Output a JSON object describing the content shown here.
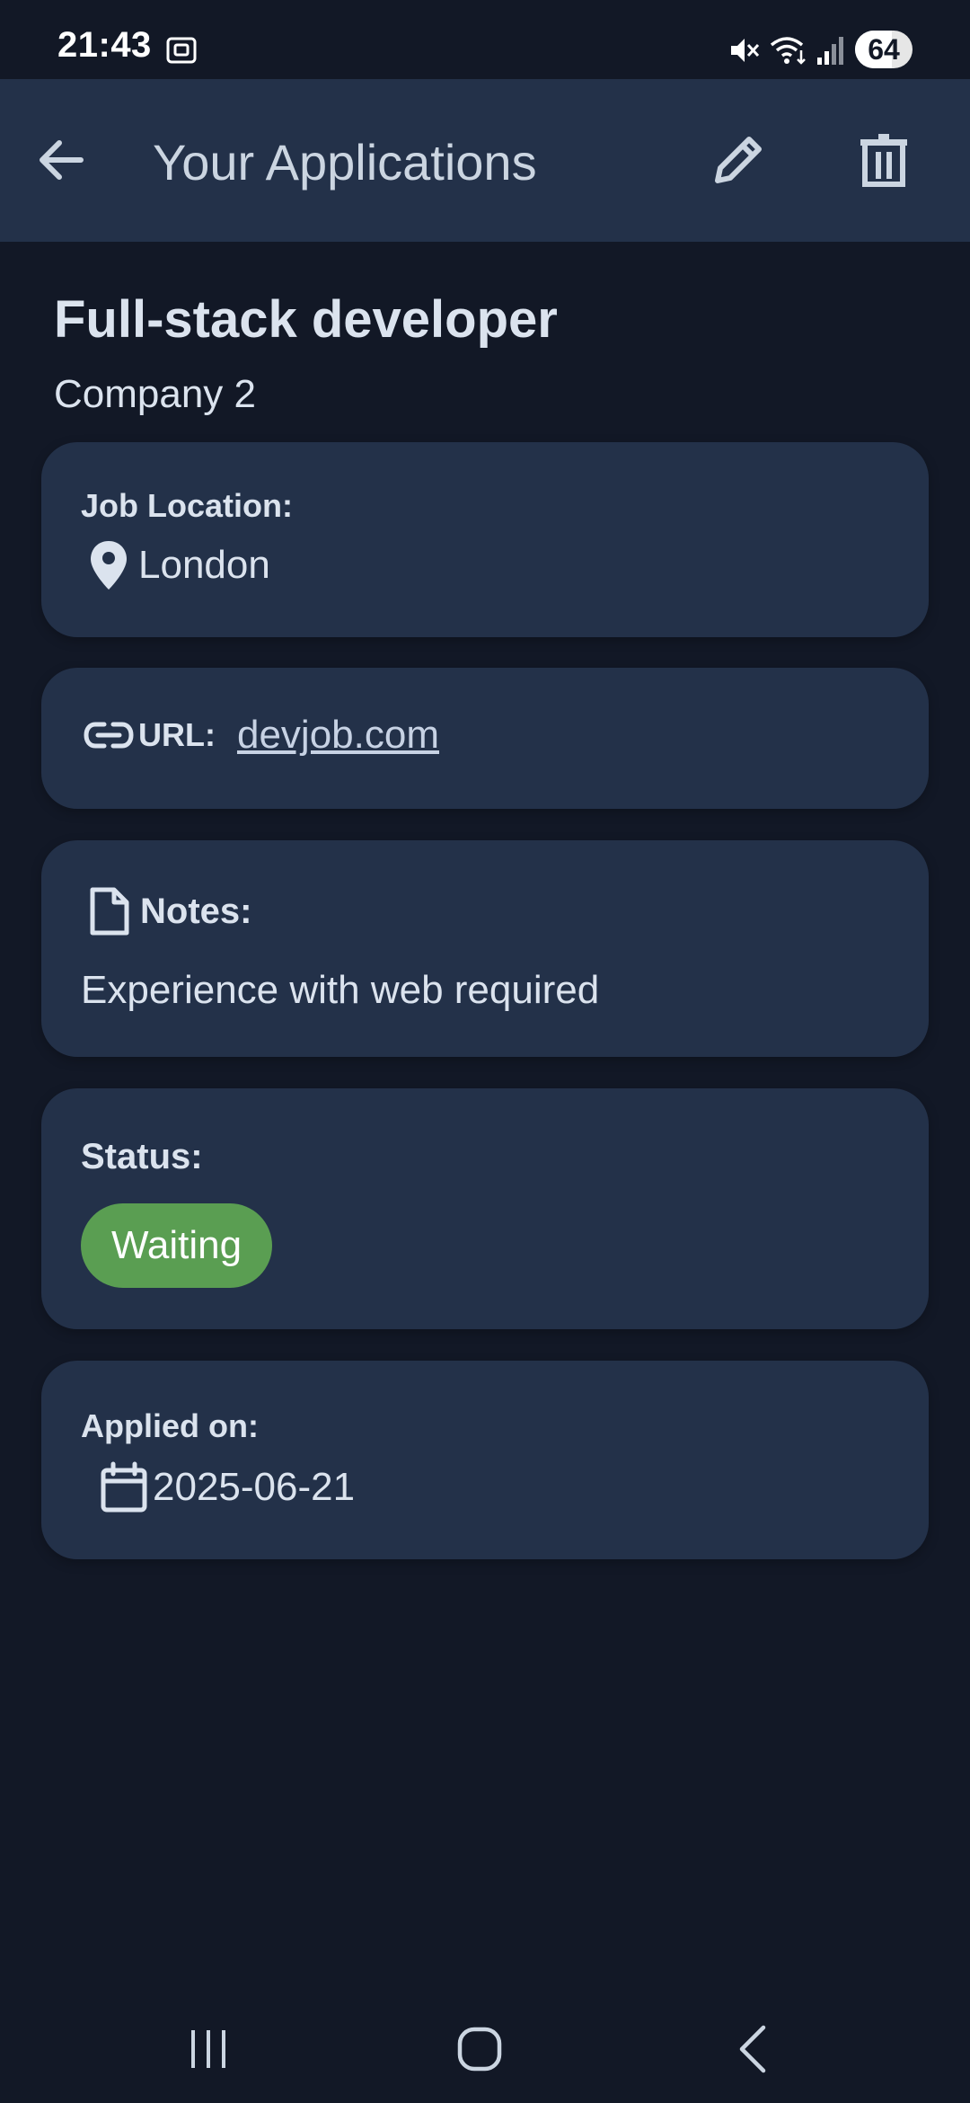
{
  "status_bar": {
    "time": "21:43",
    "battery": "64",
    "battery_level_percent": 64,
    "icons": [
      "screenshot-icon",
      "mute-icon",
      "wifi-icon",
      "signal-icon",
      "battery-icon"
    ]
  },
  "app_bar": {
    "title": "Your Applications",
    "icons": [
      "back-arrow-icon",
      "pencil-icon",
      "trash-icon"
    ]
  },
  "job": {
    "title": "Full-stack developer",
    "company": "Company 2"
  },
  "location": {
    "label": "Job Location:",
    "value": "London",
    "icon": "map-pin-icon"
  },
  "url": {
    "label": "URL:",
    "value": "devjob.com",
    "icon": "link-icon"
  },
  "notes": {
    "label": "Notes:",
    "value": "Experience with web required",
    "icon": "document-icon"
  },
  "status": {
    "label": "Status:",
    "value": "Waiting",
    "color": "#5a9e52"
  },
  "applied": {
    "label": "Applied on:",
    "value": "2025-06-21",
    "icon": "calendar-icon"
  },
  "nav_bar": {
    "icons": [
      "recents-icon",
      "home-icon",
      "back-nav-icon"
    ]
  },
  "colors": {
    "background": "#121826",
    "surface": "#233149",
    "text": "#dbe3ee",
    "accent_status": "#5a9e52"
  }
}
